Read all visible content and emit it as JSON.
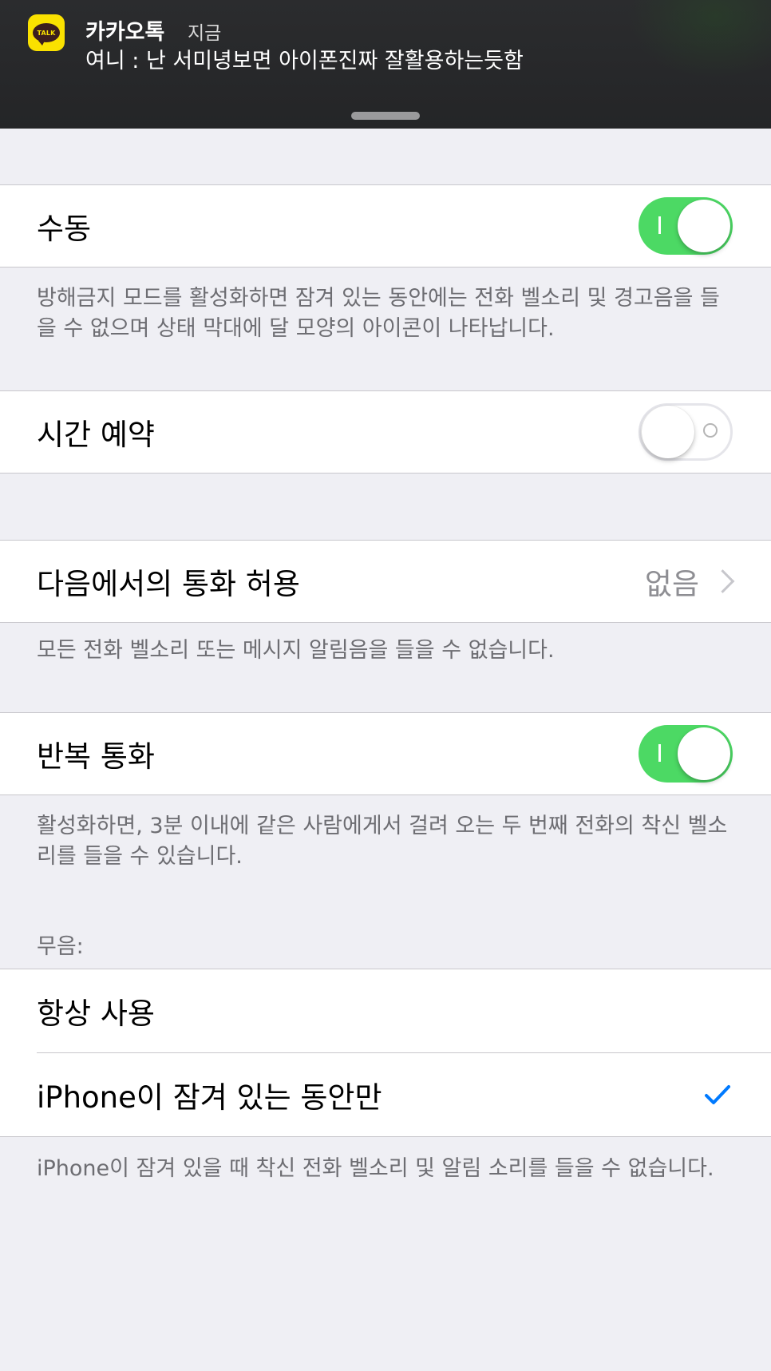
{
  "notification": {
    "app_icon_text": "TALK",
    "app_name": "카카오톡",
    "time": "지금",
    "message": "여니 : 난 서미녕보면 아이폰진짜 잘활용하는듯함"
  },
  "colors": {
    "toggle_on": "#4cd964",
    "accent_blue": "#007aff",
    "background": "#efeff4"
  },
  "settings": {
    "manual": {
      "label": "수동",
      "toggle": "on"
    },
    "manual_footer": "방해금지 모드를 활성화하면 잠겨 있는 동안에는 전화 벨소리 및 경고음을 들을 수 없으며 상태 막대에 달 모양의 아이콘이 나타납니다.",
    "scheduled": {
      "label": "시간 예약",
      "toggle": "off"
    },
    "allow_calls": {
      "label": "다음에서의 통화 허용",
      "value": "없음"
    },
    "allow_calls_footer": "모든 전화 벨소리 또는 메시지 알림음을 들을 수 없습니다.",
    "repeated_calls": {
      "label": "반복 통화",
      "toggle": "on"
    },
    "repeated_calls_footer": "활성화하면, 3분 이내에 같은 사람에게서 걸려 오는 두 번째 전화의 착신 벨소리를 들을 수 있습니다.",
    "silence_header": "무음:",
    "silence_options": [
      {
        "label": "항상 사용",
        "selected": false
      },
      {
        "label": "iPhone이 잠겨 있는 동안만",
        "selected": true
      }
    ],
    "silence_footer": "iPhone이 잠겨 있을 때 착신 전화 벨소리 및 알림 소리를 들을 수 없습니다."
  }
}
